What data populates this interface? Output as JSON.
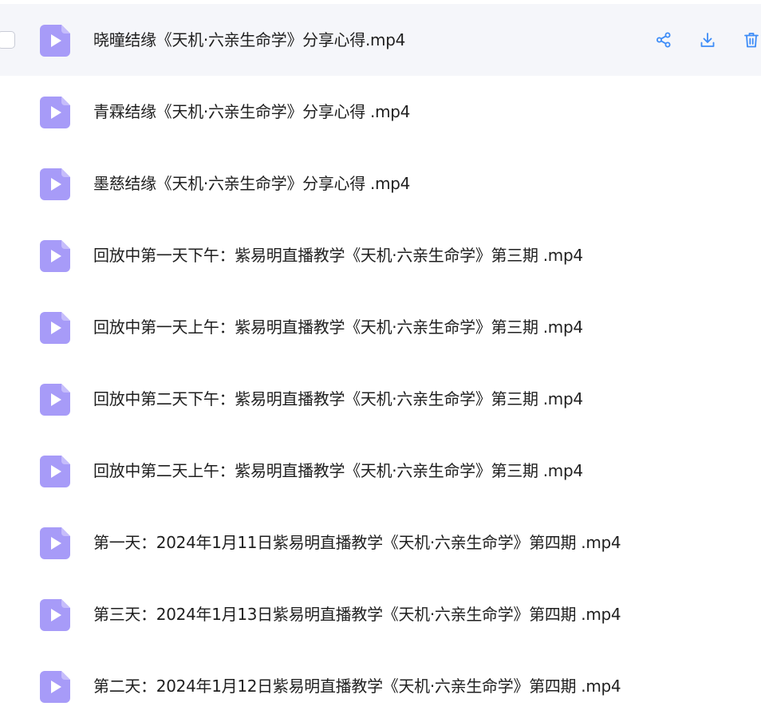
{
  "colors": {
    "accent": "#3d8cf7",
    "icon_fill": "#a79bf8",
    "hover_row_bg": "#f5f6fa",
    "text": "#1f1f1f"
  },
  "hovered_row_actions": {
    "share_icon": "share-icon",
    "download_icon": "download-icon",
    "delete_icon": "trash-icon"
  },
  "files": [
    {
      "name": "晓曈结缘《天机·六亲生命学》分享心得.mp4",
      "icon": "video-file-icon"
    },
    {
      "name": "青霖结缘《天机·六亲生命学》分享心得 .mp4",
      "icon": "video-file-icon"
    },
    {
      "name": "墨慈结缘《天机·六亲生命学》分享心得 .mp4",
      "icon": "video-file-icon"
    },
    {
      "name": "回放中第一天下午：紫易明直播教学《天机·六亲生命学》第三期 .mp4",
      "icon": "video-file-icon"
    },
    {
      "name": "回放中第一天上午：紫易明直播教学《天机·六亲生命学》第三期 .mp4",
      "icon": "video-file-icon"
    },
    {
      "name": "回放中第二天下午：紫易明直播教学《天机·六亲生命学》第三期 .mp4",
      "icon": "video-file-icon"
    },
    {
      "name": "回放中第二天上午：紫易明直播教学《天机·六亲生命学》第三期 .mp4",
      "icon": "video-file-icon"
    },
    {
      "name": "第一天：2024年1月11日紫易明直播教学《天机·六亲生命学》第四期 .mp4",
      "icon": "video-file-icon"
    },
    {
      "name": "第三天：2024年1月13日紫易明直播教学《天机·六亲生命学》第四期 .mp4",
      "icon": "video-file-icon"
    },
    {
      "name": "第二天：2024年1月12日紫易明直播教学《天机·六亲生命学》第四期 .mp4",
      "icon": "video-file-icon"
    }
  ]
}
